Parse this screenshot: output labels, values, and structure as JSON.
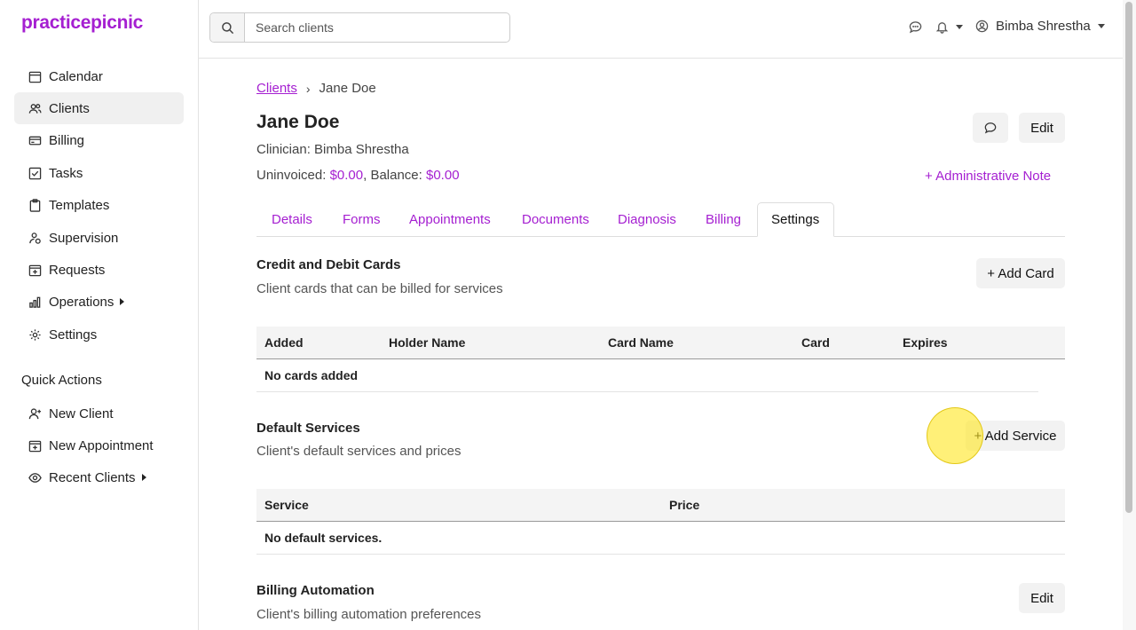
{
  "app": {
    "logo": "practicepicnic",
    "brand_color": "#a51fd1"
  },
  "sidebar": {
    "items": [
      {
        "label": "Calendar",
        "icon": "calendar-icon"
      },
      {
        "label": "Clients",
        "icon": "users-icon",
        "active": true
      },
      {
        "label": "Billing",
        "icon": "credit-card-icon"
      },
      {
        "label": "Tasks",
        "icon": "checkbox-icon"
      },
      {
        "label": "Templates",
        "icon": "clipboard-icon"
      },
      {
        "label": "Supervision",
        "icon": "supervisor-icon"
      },
      {
        "label": "Requests",
        "icon": "calendar-plus-icon"
      },
      {
        "label": "Operations",
        "icon": "bar-chart-icon",
        "expandable": true
      },
      {
        "label": "Settings",
        "icon": "gear-icon"
      }
    ],
    "quick_actions_title": "Quick Actions",
    "quick_actions": [
      {
        "label": "New Client",
        "icon": "user-plus-icon"
      },
      {
        "label": "New Appointment",
        "icon": "calendar-plus-icon"
      },
      {
        "label": "Recent Clients",
        "icon": "eye-icon",
        "expandable": true
      }
    ]
  },
  "topbar": {
    "search_placeholder": "Search clients",
    "user_name": "Bimba Shrestha"
  },
  "breadcrumb": {
    "parent": "Clients",
    "current": "Jane Doe"
  },
  "client": {
    "name": "Jane Doe",
    "clinician_line": "Clinician: Bimba Shrestha",
    "uninvoiced_label": "Uninvoiced:",
    "uninvoiced_value": "$0.00",
    "balance_label": ", Balance:",
    "balance_value": "$0.00",
    "edit_label": "Edit",
    "admin_note_label": "+ Administrative Note"
  },
  "tabs": [
    "Details",
    "Forms",
    "Appointments",
    "Documents",
    "Diagnosis",
    "Billing",
    "Settings"
  ],
  "active_tab": "Settings",
  "cards": {
    "title": "Credit and Debit Cards",
    "description": "Client cards that can be billed for services",
    "add_label": "+ Add Card",
    "columns": [
      "Added",
      "Holder Name",
      "Card Name",
      "Card",
      "Expires"
    ],
    "empty": "No cards added"
  },
  "services": {
    "title": "Default Services",
    "description": "Client's default services and prices",
    "add_label": "+ Add Service",
    "columns": [
      "Service",
      "Price"
    ],
    "empty": "No default services."
  },
  "automation": {
    "title": "Billing Automation",
    "description": "Client's billing automation preferences",
    "edit_label": "Edit"
  }
}
